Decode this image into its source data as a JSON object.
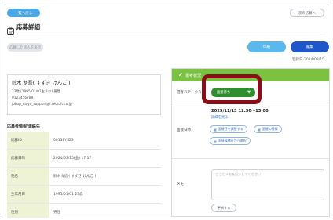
{
  "nav": {
    "back_label": "一覧へ戻る",
    "next_label": "次の応募へ"
  },
  "page": {
    "title": "応募詳細",
    "title_icon": "clipboard-icon"
  },
  "actions": {
    "undo_label": "応募した求人を表示",
    "print_label": "印刷",
    "edit_label": "編集"
  },
  "registered": "登録日:2024/03/15",
  "profile": {
    "name": "鈴木 胡吾( すずき けんご )",
    "birth": "23歳 (1995/01/01生まれ)   男性",
    "phone": "0123456789",
    "email": "jobop_saiyo_support@r.recruit.co.jp"
  },
  "contact_section": {
    "heading": "応募者情報/連絡先",
    "rows": [
      {
        "label": "応募ID",
        "value": "00138YS23"
      },
      {
        "label": "応募日時",
        "value": "2024/03/15(金) 17:17"
      },
      {
        "label": "氏名",
        "value": "鈴木 胡吾( すずき けんご )"
      },
      {
        "label": "生年月日",
        "value": "1995/01/01 23歳"
      },
      {
        "label": "性別",
        "value": "男性"
      }
    ]
  },
  "selection": {
    "header": "選考状況",
    "header_icon": "pencil-icon",
    "status_label": "選考ステータス",
    "status_value": "面接待ち",
    "status_arrow": "▼",
    "interview_label": "面接日時",
    "interview_datetime": "2025/11/13 12:30～13:00",
    "interview_link": "詳細を見る",
    "buttons": [
      {
        "label": "面接日を調整する",
        "icon": "calendar-icon"
      },
      {
        "label": "面接の登録",
        "icon": "calendar-icon"
      },
      {
        "label": "面接候補日から選択",
        "icon": "calendar-icon"
      }
    ],
    "memo_label": "メモ",
    "memo_placeholder": "ここにメモを記入してください",
    "memo_save": "更新する"
  },
  "colors": {
    "accent_green": "#7cc242",
    "status_green": "#2f8f2f",
    "highlight": "#8b0d18",
    "primary_blue": "#1d57c9",
    "light_blue": "#5bb8ee"
  }
}
